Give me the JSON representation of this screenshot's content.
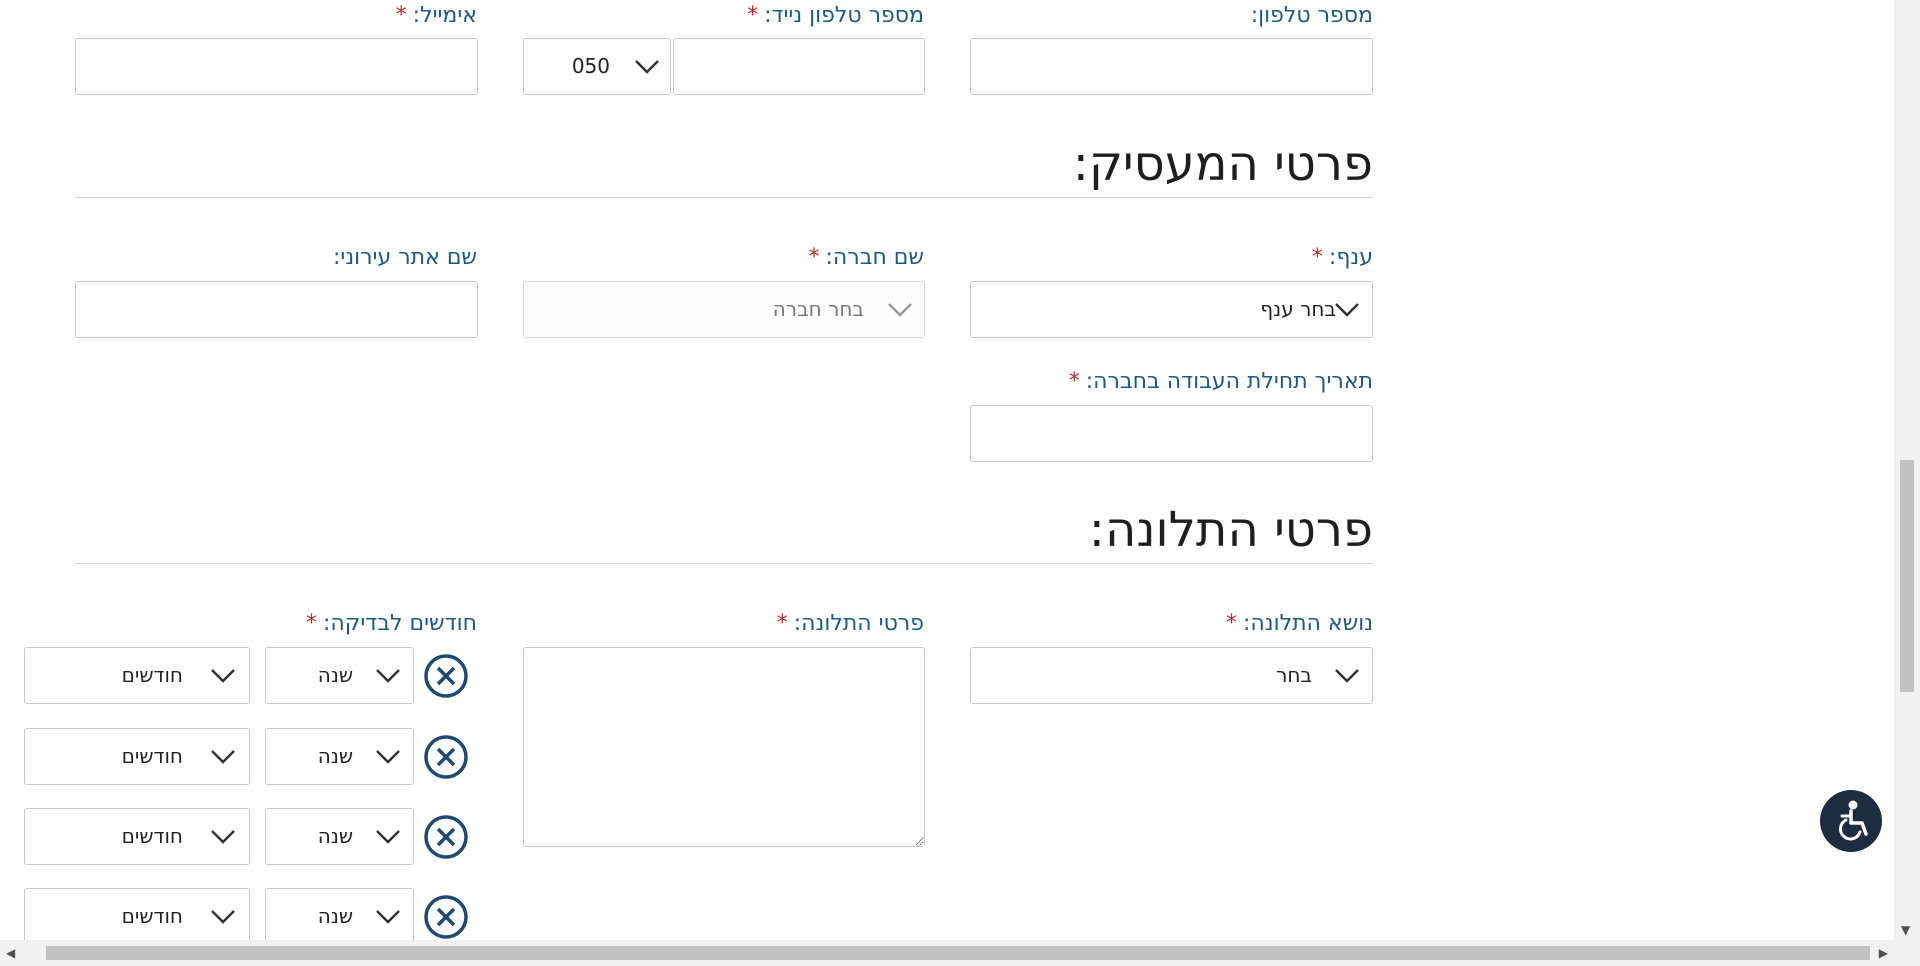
{
  "contact": {
    "phone_label": "מספר טלפון:",
    "mobile_label": "מספר טלפון נייד:",
    "mobile_prefix": "050",
    "email_label": "אימייל:"
  },
  "employer": {
    "heading": "פרטי המעסיק:",
    "branch_label": "ענף:",
    "branch_value": "בחר ענף",
    "company_label": "שם חברה:",
    "company_value": "בחר חברה",
    "city_label": "שם אתר עירוני:",
    "start_date_label": "תאריך תחילת העבודה בחברה:"
  },
  "complaint": {
    "heading": "פרטי התלונה:",
    "topic_label": "נושא התלונה:",
    "topic_value": "בחר",
    "details_label": "פרטי התלונה:",
    "months_label": "חודשים לבדיקה:",
    "rows": [
      {
        "year": "שנה",
        "months": "חודשים"
      },
      {
        "year": "שנה",
        "months": "חודשים"
      },
      {
        "year": "שנה",
        "months": "חודשים"
      },
      {
        "year": "שנה",
        "months": "חודשים"
      }
    ]
  },
  "required_mark": "*",
  "icons": {
    "chevron": "chevron-down-icon",
    "remove": "close-circle-icon",
    "accessibility": "wheelchair-icon"
  },
  "colors": {
    "label": "#1a5a85",
    "required": "#c0282d",
    "remove_icon": "#1d4a73",
    "a11y_bg": "#1d2d3f"
  }
}
